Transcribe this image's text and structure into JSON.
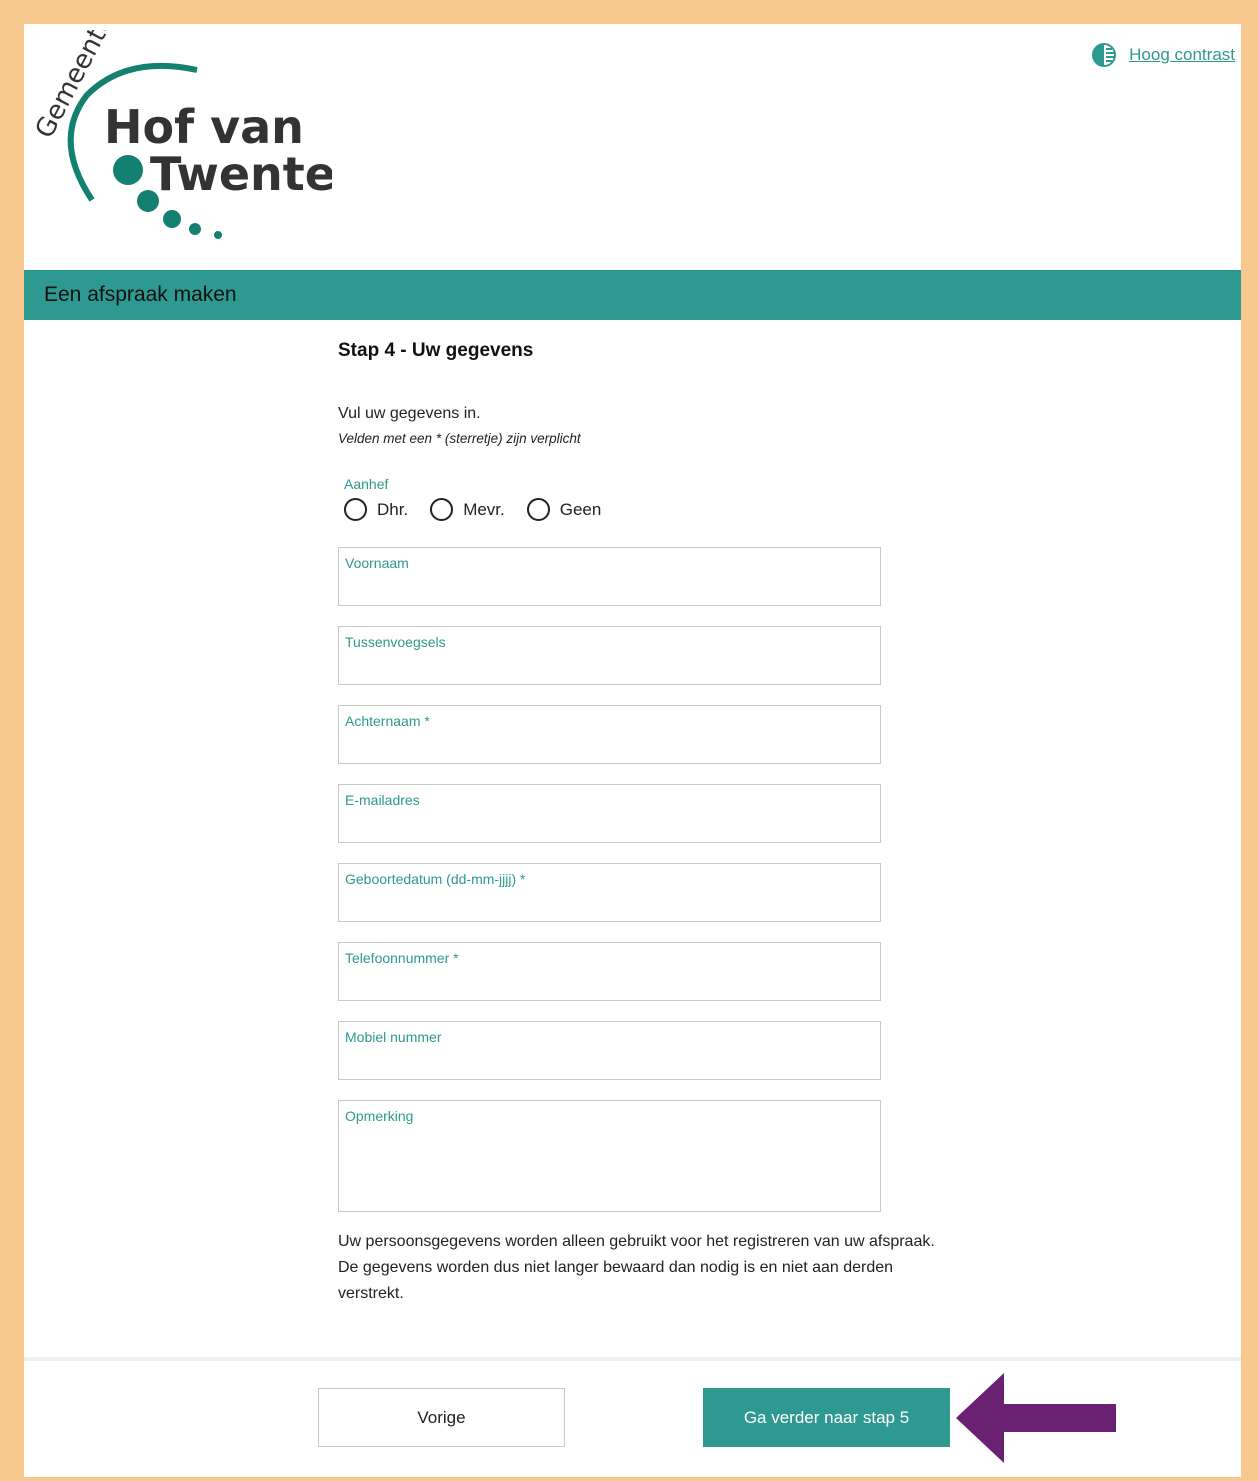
{
  "header": {
    "logo": {
      "prefix": "Gemeente",
      "line1": "Hof van",
      "line2": "Twente"
    },
    "contrast_link": "Hoog contrast",
    "contrast_icon": "contrast-icon"
  },
  "banner": {
    "title": "Een afspraak maken"
  },
  "form": {
    "step_title": "Stap 4 - Uw gegevens",
    "intro": "Vul uw gegevens in.",
    "required_note": "Velden met een * (sterretje) zijn verplicht",
    "salutation": {
      "label": "Aanhef",
      "options": [
        "Dhr.",
        "Mevr.",
        "Geen"
      ]
    },
    "fields": {
      "first_name": "Voornaam",
      "infix": "Tussenvoegsels",
      "last_name": "Achternaam *",
      "email": "E-mailadres",
      "birthdate": "Geboortedatum (dd-mm-jjjj) *",
      "phone": "Telefoonnummer *",
      "mobile": "Mobiel nummer",
      "remark": "Opmerking"
    },
    "privacy": "Uw persoonsgegevens worden alleen gebruikt voor het registreren van uw afspraak. De gegevens worden dus niet langer bewaard dan nodig is en niet aan derden verstrekt."
  },
  "footer": {
    "prev_label": "Vorige",
    "next_label": "Ga verder naar stap 5"
  },
  "colors": {
    "accent": "#2e9990",
    "frame": "#f7c98f",
    "annotation_arrow": "#6b2172"
  }
}
